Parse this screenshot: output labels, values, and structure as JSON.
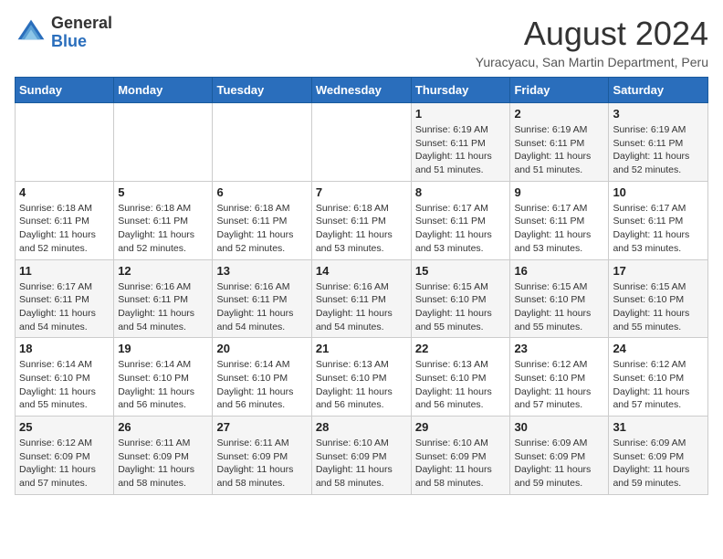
{
  "header": {
    "logo_general": "General",
    "logo_blue": "Blue",
    "month_year": "August 2024",
    "location": "Yuracyacu, San Martin Department, Peru"
  },
  "days_of_week": [
    "Sunday",
    "Monday",
    "Tuesday",
    "Wednesday",
    "Thursday",
    "Friday",
    "Saturday"
  ],
  "weeks": [
    [
      {
        "num": "",
        "info": ""
      },
      {
        "num": "",
        "info": ""
      },
      {
        "num": "",
        "info": ""
      },
      {
        "num": "",
        "info": ""
      },
      {
        "num": "1",
        "info": "Sunrise: 6:19 AM\nSunset: 6:11 PM\nDaylight: 11 hours\nand 51 minutes."
      },
      {
        "num": "2",
        "info": "Sunrise: 6:19 AM\nSunset: 6:11 PM\nDaylight: 11 hours\nand 51 minutes."
      },
      {
        "num": "3",
        "info": "Sunrise: 6:19 AM\nSunset: 6:11 PM\nDaylight: 11 hours\nand 52 minutes."
      }
    ],
    [
      {
        "num": "4",
        "info": "Sunrise: 6:18 AM\nSunset: 6:11 PM\nDaylight: 11 hours\nand 52 minutes."
      },
      {
        "num": "5",
        "info": "Sunrise: 6:18 AM\nSunset: 6:11 PM\nDaylight: 11 hours\nand 52 minutes."
      },
      {
        "num": "6",
        "info": "Sunrise: 6:18 AM\nSunset: 6:11 PM\nDaylight: 11 hours\nand 52 minutes."
      },
      {
        "num": "7",
        "info": "Sunrise: 6:18 AM\nSunset: 6:11 PM\nDaylight: 11 hours\nand 53 minutes."
      },
      {
        "num": "8",
        "info": "Sunrise: 6:17 AM\nSunset: 6:11 PM\nDaylight: 11 hours\nand 53 minutes."
      },
      {
        "num": "9",
        "info": "Sunrise: 6:17 AM\nSunset: 6:11 PM\nDaylight: 11 hours\nand 53 minutes."
      },
      {
        "num": "10",
        "info": "Sunrise: 6:17 AM\nSunset: 6:11 PM\nDaylight: 11 hours\nand 53 minutes."
      }
    ],
    [
      {
        "num": "11",
        "info": "Sunrise: 6:17 AM\nSunset: 6:11 PM\nDaylight: 11 hours\nand 54 minutes."
      },
      {
        "num": "12",
        "info": "Sunrise: 6:16 AM\nSunset: 6:11 PM\nDaylight: 11 hours\nand 54 minutes."
      },
      {
        "num": "13",
        "info": "Sunrise: 6:16 AM\nSunset: 6:11 PM\nDaylight: 11 hours\nand 54 minutes."
      },
      {
        "num": "14",
        "info": "Sunrise: 6:16 AM\nSunset: 6:11 PM\nDaylight: 11 hours\nand 54 minutes."
      },
      {
        "num": "15",
        "info": "Sunrise: 6:15 AM\nSunset: 6:10 PM\nDaylight: 11 hours\nand 55 minutes."
      },
      {
        "num": "16",
        "info": "Sunrise: 6:15 AM\nSunset: 6:10 PM\nDaylight: 11 hours\nand 55 minutes."
      },
      {
        "num": "17",
        "info": "Sunrise: 6:15 AM\nSunset: 6:10 PM\nDaylight: 11 hours\nand 55 minutes."
      }
    ],
    [
      {
        "num": "18",
        "info": "Sunrise: 6:14 AM\nSunset: 6:10 PM\nDaylight: 11 hours\nand 55 minutes."
      },
      {
        "num": "19",
        "info": "Sunrise: 6:14 AM\nSunset: 6:10 PM\nDaylight: 11 hours\nand 56 minutes."
      },
      {
        "num": "20",
        "info": "Sunrise: 6:14 AM\nSunset: 6:10 PM\nDaylight: 11 hours\nand 56 minutes."
      },
      {
        "num": "21",
        "info": "Sunrise: 6:13 AM\nSunset: 6:10 PM\nDaylight: 11 hours\nand 56 minutes."
      },
      {
        "num": "22",
        "info": "Sunrise: 6:13 AM\nSunset: 6:10 PM\nDaylight: 11 hours\nand 56 minutes."
      },
      {
        "num": "23",
        "info": "Sunrise: 6:12 AM\nSunset: 6:10 PM\nDaylight: 11 hours\nand 57 minutes."
      },
      {
        "num": "24",
        "info": "Sunrise: 6:12 AM\nSunset: 6:10 PM\nDaylight: 11 hours\nand 57 minutes."
      }
    ],
    [
      {
        "num": "25",
        "info": "Sunrise: 6:12 AM\nSunset: 6:09 PM\nDaylight: 11 hours\nand 57 minutes."
      },
      {
        "num": "26",
        "info": "Sunrise: 6:11 AM\nSunset: 6:09 PM\nDaylight: 11 hours\nand 58 minutes."
      },
      {
        "num": "27",
        "info": "Sunrise: 6:11 AM\nSunset: 6:09 PM\nDaylight: 11 hours\nand 58 minutes."
      },
      {
        "num": "28",
        "info": "Sunrise: 6:10 AM\nSunset: 6:09 PM\nDaylight: 11 hours\nand 58 minutes."
      },
      {
        "num": "29",
        "info": "Sunrise: 6:10 AM\nSunset: 6:09 PM\nDaylight: 11 hours\nand 58 minutes."
      },
      {
        "num": "30",
        "info": "Sunrise: 6:09 AM\nSunset: 6:09 PM\nDaylight: 11 hours\nand 59 minutes."
      },
      {
        "num": "31",
        "info": "Sunrise: 6:09 AM\nSunset: 6:09 PM\nDaylight: 11 hours\nand 59 minutes."
      }
    ]
  ]
}
